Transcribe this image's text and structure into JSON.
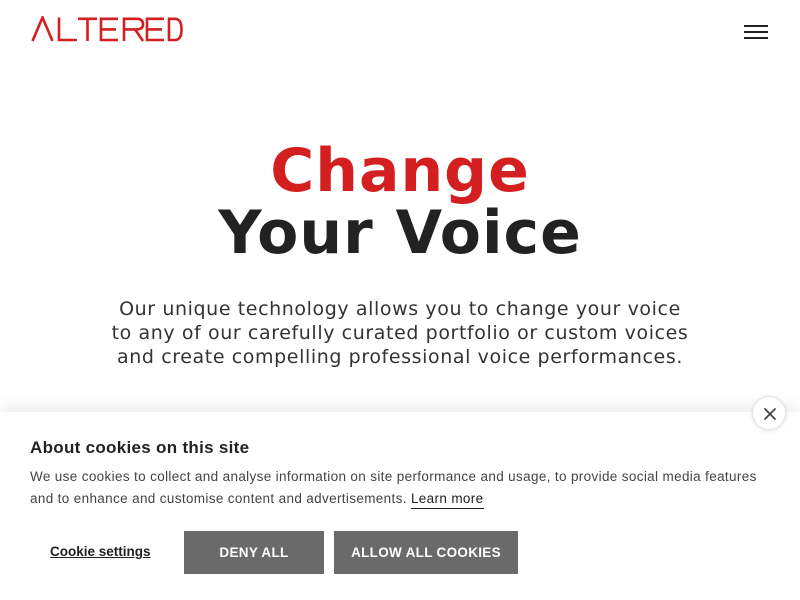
{
  "brand": {
    "logo_text": "ALTERED",
    "accent_color": "#d31f1f",
    "logo_icon": "altered-wordmark"
  },
  "nav": {
    "menu_icon": "hamburger-menu-icon"
  },
  "hero": {
    "line1": "Change",
    "line2": "Your Voice",
    "description": "Our unique technology allows you to change your voice to any of our carefully curated portfolio or custom voices and create compelling professional voice performances."
  },
  "cookie_banner": {
    "title": "About cookies on this site",
    "text": "We use cookies to collect and analyse information on site performance and usage, to provide social media features and to enhance and customise content and advertisements.",
    "learn_more": "Learn more",
    "settings_label": "Cookie settings",
    "deny_label": "DENY ALL",
    "allow_label": "ALLOW ALL COOKIES",
    "close_icon": "close-icon",
    "button_color": "#6a6a6a"
  }
}
